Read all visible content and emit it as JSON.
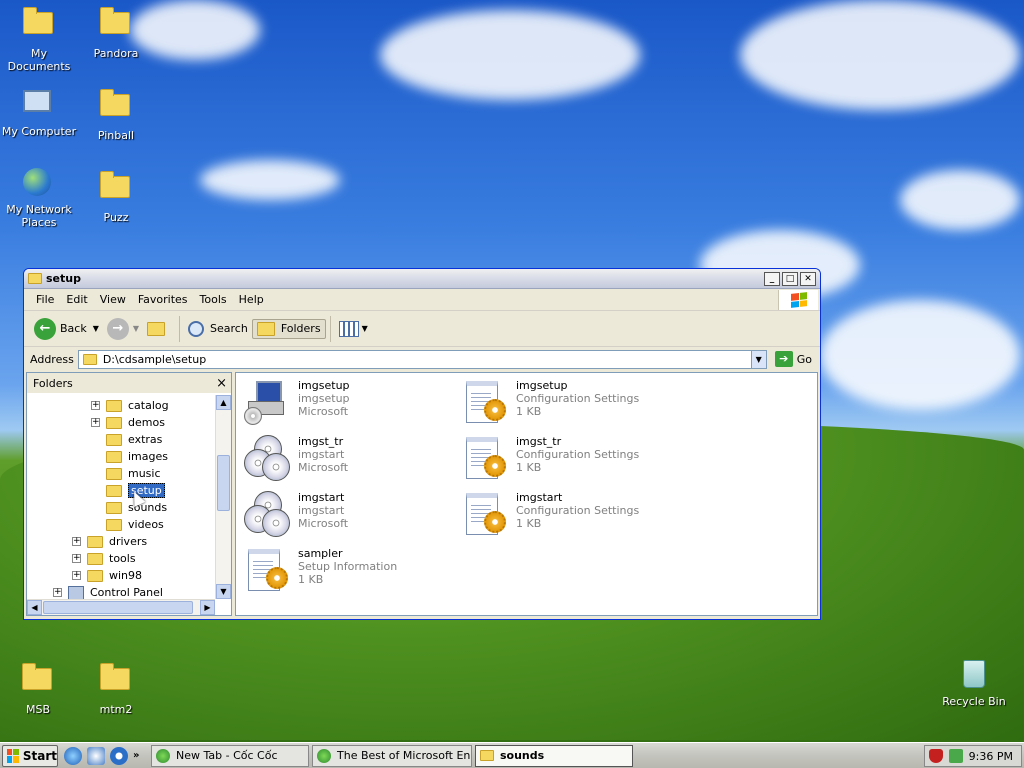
{
  "desktop": {
    "icons": [
      {
        "label": "My Documents"
      },
      {
        "label": "Pandora"
      },
      {
        "label": "My Computer"
      },
      {
        "label": "Pinball"
      },
      {
        "label": "My Network Places"
      },
      {
        "label": "Puzz"
      },
      {
        "label": "MSB"
      },
      {
        "label": "mtm2"
      },
      {
        "label": "Recycle Bin"
      }
    ]
  },
  "window": {
    "title": "setup",
    "menu": [
      "File",
      "Edit",
      "View",
      "Favorites",
      "Tools",
      "Help"
    ],
    "toolbar": {
      "back": "Back",
      "search": "Search",
      "folders": "Folders"
    },
    "address": {
      "label": "Address",
      "value": "D:\\cdsample\\setup",
      "go": "Go"
    },
    "folders_pane": {
      "title": "Folders",
      "close": "×",
      "tree": [
        {
          "label": "catalog",
          "expand": "+"
        },
        {
          "label": "demos",
          "expand": "+"
        },
        {
          "label": "extras"
        },
        {
          "label": "images"
        },
        {
          "label": "music"
        },
        {
          "label": "setup"
        },
        {
          "label": "sounds"
        },
        {
          "label": "videos"
        },
        {
          "label": "drivers",
          "expand": "+"
        },
        {
          "label": "tools",
          "expand": "+"
        },
        {
          "label": "win98",
          "expand": "+"
        },
        {
          "label": "Control Panel",
          "expand": "+"
        }
      ]
    },
    "files": [
      {
        "name": "imgsetup",
        "line2": "imgsetup",
        "line3": "Microsoft",
        "icon": "setup-program-icon"
      },
      {
        "name": "imgsetup",
        "line2": "Configuration Settings",
        "line3": "1 KB",
        "icon": "config-settings-icon"
      },
      {
        "name": "imgst_tr",
        "line2": "imgstart",
        "line3": "Microsoft",
        "icon": "cd-program-icon"
      },
      {
        "name": "imgst_tr",
        "line2": "Configuration Settings",
        "line3": "1 KB",
        "icon": "config-settings-icon"
      },
      {
        "name": "imgstart",
        "line2": "imgstart",
        "line3": "Microsoft",
        "icon": "cd-program-icon"
      },
      {
        "name": "imgstart",
        "line2": "Configuration Settings",
        "line3": "1 KB",
        "icon": "config-settings-icon"
      },
      {
        "name": "sampler",
        "line2": "Setup Information",
        "line3": "1 KB",
        "icon": "setup-info-icon"
      }
    ]
  },
  "taskbar": {
    "start": "Start",
    "tasks": [
      {
        "label": "New Tab - Cốc Cốc"
      },
      {
        "label": "The Best of Microsoft En..."
      },
      {
        "label": "sounds"
      }
    ],
    "clock": "9:36 PM"
  },
  "colors": {
    "selection": "#316ac5",
    "title_border": "#0831d9",
    "xp_red": "#f25022",
    "xp_green": "#7fba00",
    "xp_blue": "#00a4ef",
    "xp_yellow": "#ffb900"
  }
}
